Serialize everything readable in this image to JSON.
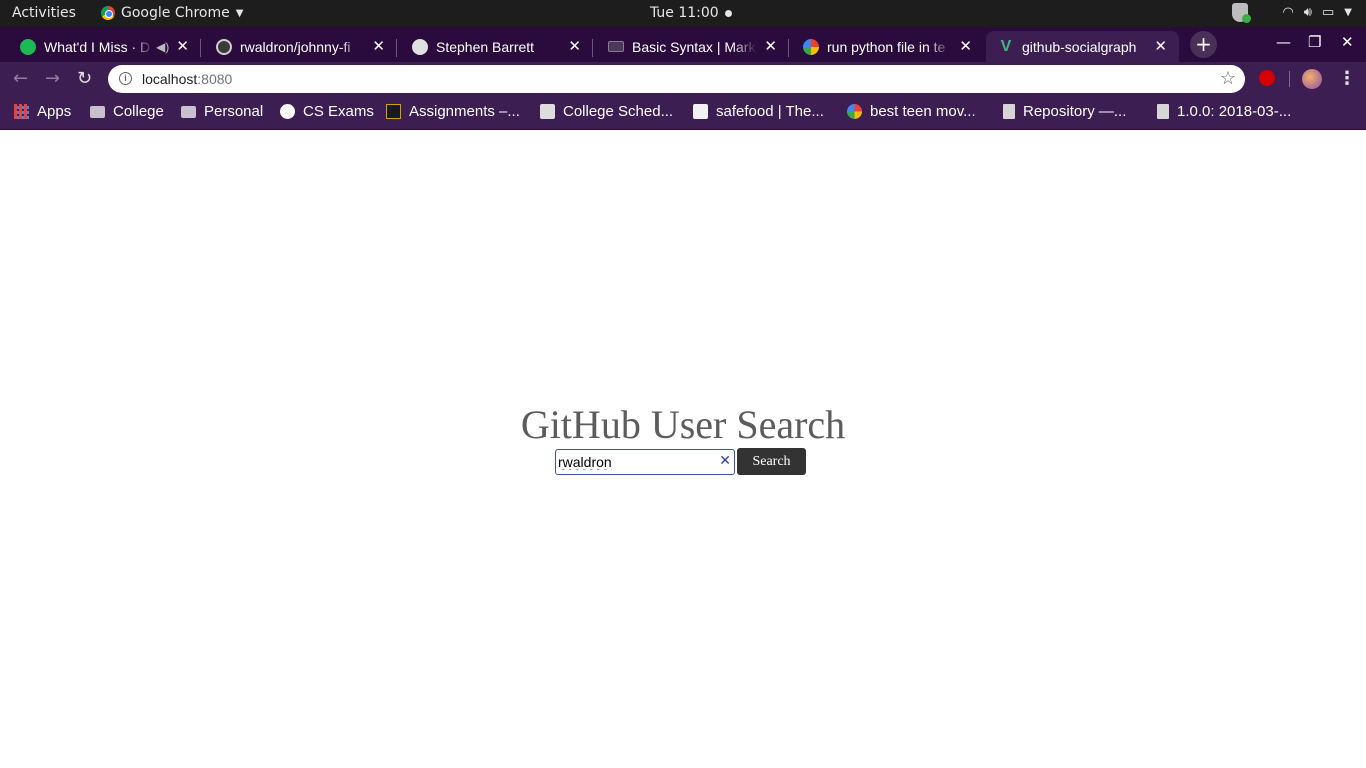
{
  "system_bar": {
    "activities": "Activities",
    "app_name": "Google Chrome",
    "clock": "Tue 11:00"
  },
  "tabs": [
    {
      "title": "What'd I Miss · D",
      "favicon": "spotify-icon",
      "active": false
    },
    {
      "title": "rwaldron/johnny-fi",
      "favicon": "github-icon",
      "active": false
    },
    {
      "title": "Stephen Barrett",
      "favicon": "globe-icon",
      "active": false
    },
    {
      "title": "Basic Syntax | Mark",
      "favicon": "markdown-icon",
      "active": false
    },
    {
      "title": "run python file in te",
      "favicon": "google-icon",
      "active": false
    },
    {
      "title": "github-socialgraph",
      "favicon": "vue-icon",
      "active": true
    }
  ],
  "toolbar": {
    "url_host": "localhost",
    "url_port": ":8080"
  },
  "bookmarks": [
    {
      "label": "Apps",
      "icon": "apps-grid-icon"
    },
    {
      "label": "College",
      "icon": "folder-icon"
    },
    {
      "label": "Personal",
      "icon": "folder-icon"
    },
    {
      "label": "CS Exams",
      "icon": "cs-exams-icon"
    },
    {
      "label": "Assignments –...",
      "icon": "blackboard-icon"
    },
    {
      "label": "College Sched...",
      "icon": "schedule-icon"
    },
    {
      "label": "safefood | The...",
      "icon": "safefood-icon"
    },
    {
      "label": "best teen mov...",
      "icon": "google-icon"
    },
    {
      "label": "Repository —...",
      "icon": "repository-icon"
    },
    {
      "label": "1.0.0: 2018-03-...",
      "icon": "repository-icon"
    }
  ],
  "main": {
    "title": "GitHub User Search",
    "search_value": "rwaldron",
    "search_button_label": "Search"
  }
}
